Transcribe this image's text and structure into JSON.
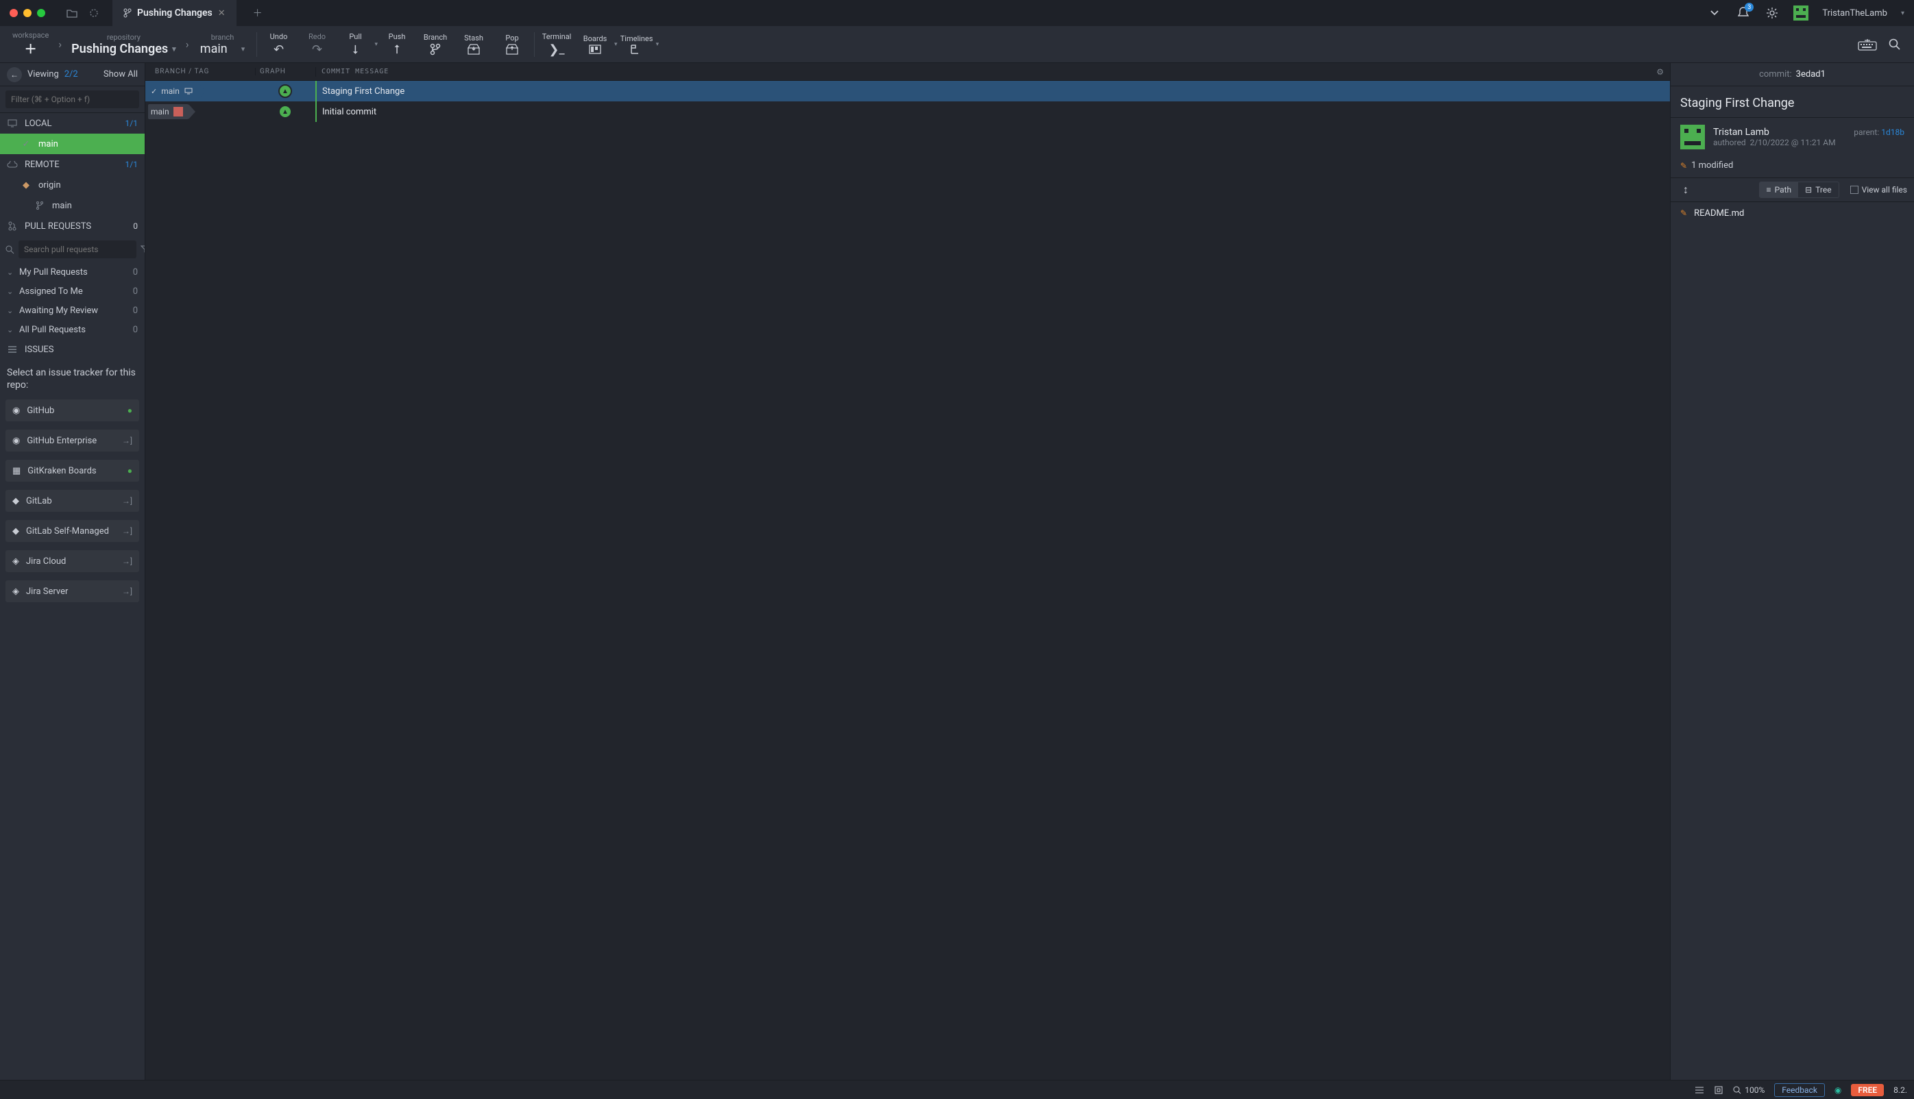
{
  "titlebar": {
    "tab_title": "Pushing Changes",
    "notif_count": "3",
    "username": "TristanTheLamb"
  },
  "breadcrumbs": {
    "workspace_label": "workspace",
    "repository_label": "repository",
    "repository_value": "Pushing Changes",
    "branch_label": "branch",
    "branch_value": "main"
  },
  "toolbar": {
    "undo": "Undo",
    "redo": "Redo",
    "pull": "Pull",
    "push": "Push",
    "branch": "Branch",
    "stash": "Stash",
    "pop": "Pop",
    "terminal": "Terminal",
    "boards": "Boards",
    "timelines": "Timelines"
  },
  "left": {
    "viewing_label": "Viewing",
    "viewing_count": "2/2",
    "show_all": "Show All",
    "filter_placeholder": "Filter (⌘ + Option + f)",
    "local_label": "LOCAL",
    "local_count": "1/1",
    "local_branch_main": "main",
    "remote_label": "REMOTE",
    "remote_count": "1/1",
    "remote_origin": "origin",
    "remote_main": "main",
    "pr_label": "PULL REQUESTS",
    "pr_count": "0",
    "pr_search_placeholder": "Search pull requests",
    "pr_cats": {
      "my": "My Pull Requests",
      "assigned": "Assigned To Me",
      "awaiting": "Awaiting My Review",
      "all": "All Pull Requests"
    },
    "pr_cat_count": "0",
    "issues_label": "ISSUES",
    "issue_prompt": "Select an issue tracker for this repo:",
    "trackers": {
      "github": "GitHub",
      "ghe": "GitHub Enterprise",
      "gkboards": "GitKraken Boards",
      "gitlab": "GitLab",
      "gitlab_sm": "GitLab Self-Managed",
      "jira_cloud": "Jira Cloud",
      "jira_server": "Jira Server"
    }
  },
  "graph": {
    "header_branch": "BRANCH / TAG",
    "header_graph": "GRAPH",
    "header_msg": "COMMIT MESSAGE",
    "commits": [
      {
        "branch": "main",
        "msg": "Staging First Change"
      },
      {
        "branch": "main",
        "msg": "Initial commit"
      }
    ]
  },
  "detail": {
    "commit_label": "commit:",
    "commit_hash": "3edad1",
    "title": "Staging First Change",
    "author": "Tristan Lamb",
    "authored_label": "authored",
    "date": "2/10/2022 @ 11:21 AM",
    "parent_label": "parent:",
    "parent_hash": "1d18b",
    "modified": "1 modified",
    "path_label": "Path",
    "tree_label": "Tree",
    "viewall_label": "View all files",
    "file": "README.md"
  },
  "statusbar": {
    "zoom": "100%",
    "feedback": "Feedback",
    "free": "FREE",
    "version": "8.2."
  }
}
